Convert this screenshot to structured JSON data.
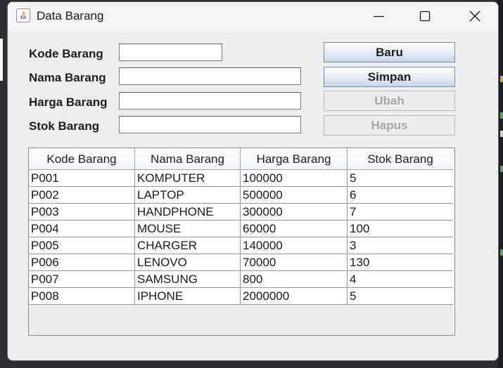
{
  "window": {
    "title": "Data Barang"
  },
  "form": {
    "kode_label": "Kode Barang",
    "nama_label": "Nama Barang",
    "harga_label": "Harga Barang",
    "stok_label": "Stok Barang",
    "kode_value": "",
    "nama_value": "",
    "harga_value": "",
    "stok_value": ""
  },
  "buttons": {
    "baru": "Baru",
    "simpan": "Simpan",
    "ubah": "Ubah",
    "hapus": "Hapus"
  },
  "table": {
    "columns": [
      "Kode Barang",
      "Nama Barang",
      "Harga Barang",
      "Stok Barang"
    ],
    "rows": [
      [
        "P001",
        "KOMPUTER",
        "100000",
        "5"
      ],
      [
        "P002",
        "LAPTOP",
        "500000",
        "6"
      ],
      [
        "P003",
        "HANDPHONE",
        "300000",
        "7"
      ],
      [
        "P004",
        "MOUSE",
        "60000",
        "100"
      ],
      [
        "P005",
        "CHARGER",
        "140000",
        "3"
      ],
      [
        "P006",
        "LENOVO",
        "70000",
        "130"
      ],
      [
        "P007",
        "SAMSUNG",
        "800",
        "4"
      ],
      [
        "P008",
        "IPHONE",
        "2000000",
        "5"
      ]
    ]
  }
}
